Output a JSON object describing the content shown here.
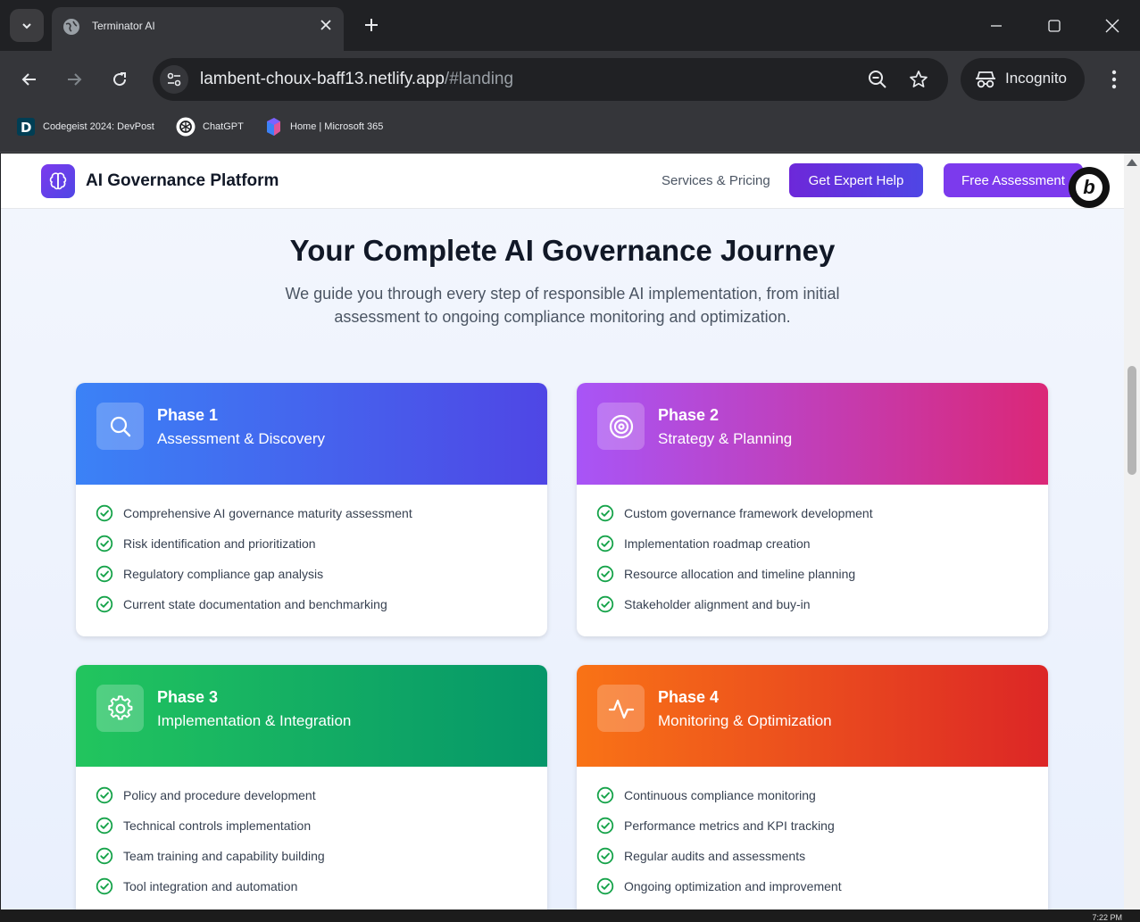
{
  "browser": {
    "tab_title": "Terminator AI",
    "url_host": "lambent-choux-baff13.netlify.app",
    "url_path": "/#landing",
    "incognito_label": "Incognito",
    "bookmarks": [
      {
        "label": "Codegeist 2024: DevPost",
        "icon": "devpost-icon"
      },
      {
        "label": "ChatGPT",
        "icon": "chatgpt-icon"
      },
      {
        "label": "Home | Microsoft 365",
        "icon": "microsoft365-icon"
      }
    ],
    "taskbar_time": "7:22 PM"
  },
  "header": {
    "brand": "AI Governance Platform",
    "nav_services": "Services & Pricing",
    "btn_expert": "Get Expert Help",
    "btn_free": "Free Assessment"
  },
  "hero": {
    "title": "Your Complete AI Governance Journey",
    "subtitle": "We guide you through every step of responsible AI implementation, from initial assessment to ongoing compliance monitoring and optimization."
  },
  "phases": [
    {
      "phase": "Phase 1",
      "name": "Assessment & Discovery",
      "icon": "search-icon",
      "colors": [
        "#3b82f6",
        "#4f46e5"
      ],
      "items": [
        "Comprehensive AI governance maturity assessment",
        "Risk identification and prioritization",
        "Regulatory compliance gap analysis",
        "Current state documentation and benchmarking"
      ]
    },
    {
      "phase": "Phase 2",
      "name": "Strategy & Planning",
      "icon": "target-icon",
      "colors": [
        "#a855f7",
        "#db2777"
      ],
      "items": [
        "Custom governance framework development",
        "Implementation roadmap creation",
        "Resource allocation and timeline planning",
        "Stakeholder alignment and buy-in"
      ]
    },
    {
      "phase": "Phase 3",
      "name": "Implementation & Integration",
      "icon": "gear-icon",
      "colors": [
        "#22c55e",
        "#059669"
      ],
      "items": [
        "Policy and procedure development",
        "Technical controls implementation",
        "Team training and capability building",
        "Tool integration and automation"
      ]
    },
    {
      "phase": "Phase 4",
      "name": "Monitoring & Optimization",
      "icon": "activity-icon",
      "colors": [
        "#f97316",
        "#dc2626"
      ],
      "items": [
        "Continuous compliance monitoring",
        "Performance metrics and KPI tracking",
        "Regular audits and assessments",
        "Ongoing optimization and improvement"
      ]
    }
  ],
  "colors": {
    "check": "#16a34a",
    "primary": "#7c3aed"
  }
}
